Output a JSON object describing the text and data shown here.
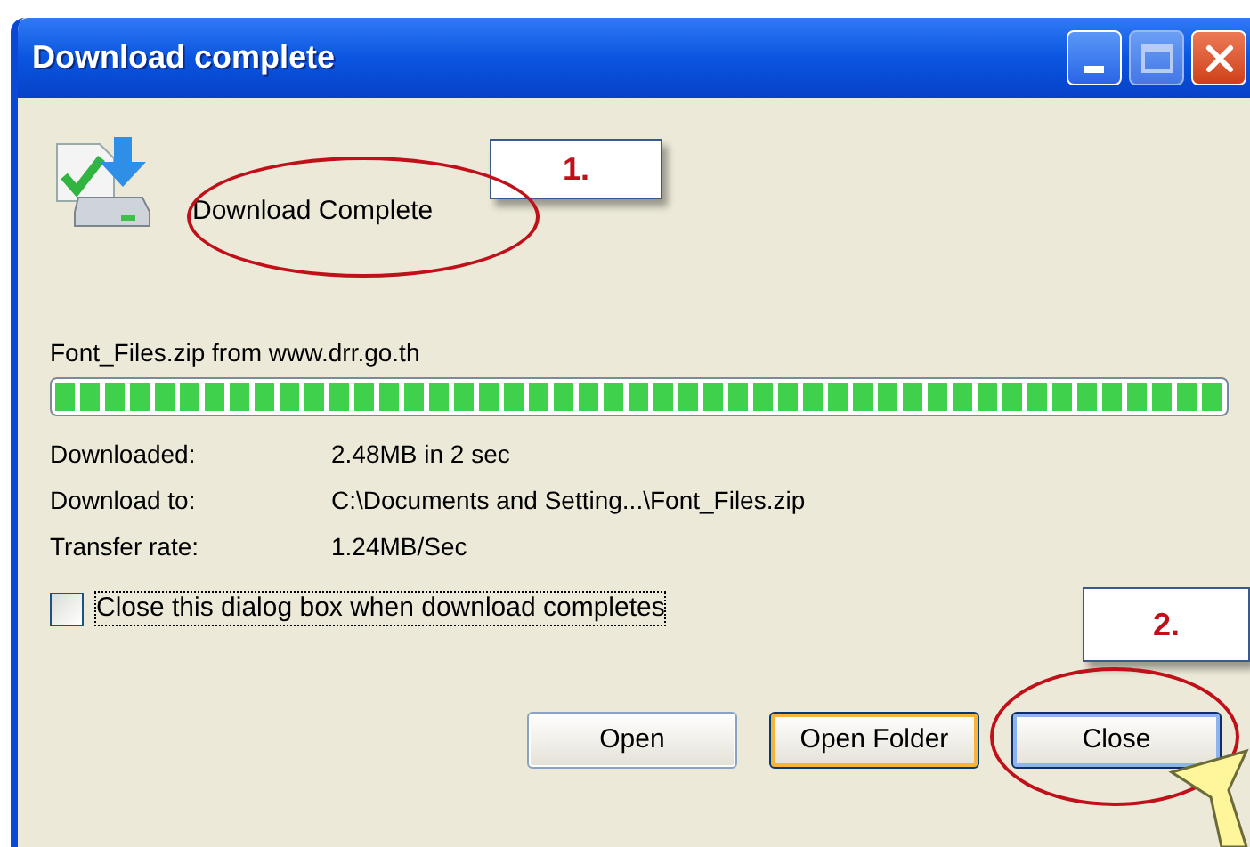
{
  "window": {
    "title": "Download complete"
  },
  "status": "Download Complete",
  "source": "Font_Files.zip from www.drr.go.th",
  "progress": {
    "level": 1
  },
  "details": [
    {
      "label": "Downloaded:",
      "value": "2.48MB in 2 sec"
    },
    {
      "label": "Download to:",
      "value": "C:\\Documents and Setting...\\Font_Files.zip"
    },
    {
      "label": "Transfer rate:",
      "value": "1.24MB/Sec"
    }
  ],
  "close_option": {
    "label": "Close this dialog box when download completes",
    "checked": false
  },
  "buttons": [
    {
      "label": "Open",
      "highlighted": false,
      "focused": false
    },
    {
      "label": "Open Folder",
      "highlighted": true,
      "focused": false
    },
    {
      "label": "Close",
      "highlighted": false,
      "focused": true
    }
  ],
  "annotations": [
    {
      "label": "1."
    },
    {
      "label": "2."
    }
  ]
}
